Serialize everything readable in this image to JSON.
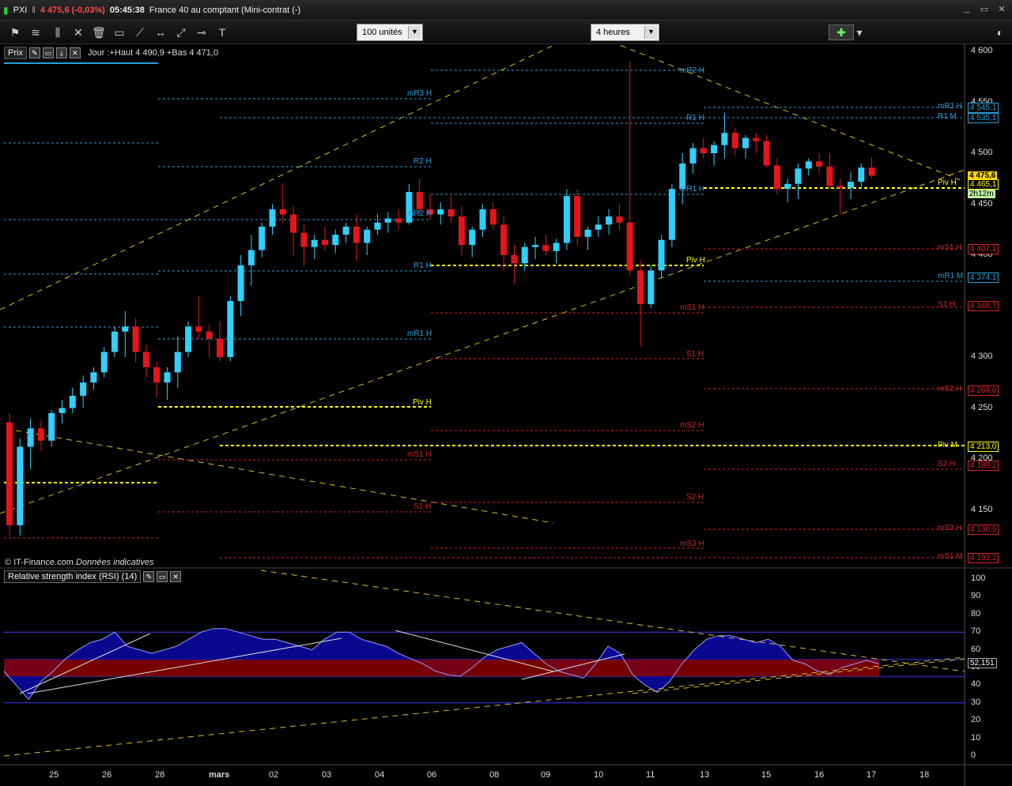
{
  "window": {
    "symbol": "PXI",
    "quote": "4 475,6 (-0,03%)",
    "time": "05:45:38",
    "instrument": "France 40 au comptant (Mini-contrat  (-)"
  },
  "toolbar": {
    "units_select": "100 unités",
    "period_select": "4 heures"
  },
  "panel": {
    "price_label": "Prix",
    "day_info": "Jour :+Haut 4 490,9 +Bas 4 471,0",
    "rsi_label": "Relative strength index (RSI) (14)",
    "credit": "© IT-Finance.com",
    "credit_note": "Données indicatives"
  },
  "colors": {
    "bull": "#2fd0ff",
    "bear": "#e8141c",
    "pivot": "#ffff00",
    "resistance": "#2a9fd8",
    "support": "#d42424",
    "rsi_fill": "#0a0aa0",
    "rsi_red": "#8b0000"
  },
  "price_axis": {
    "ticks": [
      "4 600",
      "4 550",
      "4 500",
      "4 450",
      "4 400",
      "4 350",
      "4 300",
      "4 250",
      "4 200",
      "4 150"
    ],
    "current_price_tag": "4 475,6",
    "timer_tag": "2h12m",
    "value_tags": [
      {
        "label": "mR1 H",
        "value": "4 545,1",
        "kind": "resistance"
      },
      {
        "label": "R1 M",
        "value": "4 535,1",
        "kind": "resistance"
      },
      {
        "label": "Piv H",
        "value": "4 465,1",
        "kind": "pivot"
      },
      {
        "label": "mS1 H",
        "value": "4 407,1",
        "kind": "support"
      },
      {
        "label": "mR1 M",
        "value": "4 374,1",
        "kind": "resistance"
      },
      {
        "label": "S1 H",
        "value": "4 348,7",
        "kind": "support"
      },
      {
        "label": "mS2 H",
        "value": "4 269,0",
        "kind": "support"
      },
      {
        "label": "Piv M",
        "value": "4 213,0",
        "kind": "pivot"
      },
      {
        "label": "S2 H",
        "value": "4 189,2",
        "kind": "support"
      },
      {
        "label": "mS3 H",
        "value": "4 130,9",
        "kind": "support"
      },
      {
        "label": "mS1 M",
        "value": "4 103,2",
        "kind": "support"
      }
    ]
  },
  "level_labels": [
    "mR2 H",
    "mR3 H",
    "R1 H",
    "R2 H",
    "mR2 H",
    "mR1 H",
    "R1 H",
    "Piv H",
    "mR1 H",
    "Piv H",
    "mS1 H",
    "S1 H",
    "mS2 H",
    "mS1 H",
    "S1 H",
    "S2 H",
    "mS3 H"
  ],
  "rsi_axis": {
    "ticks": [
      "100",
      "90",
      "80",
      "70",
      "60",
      "50",
      "40",
      "30",
      "20",
      "10",
      "0"
    ],
    "value_tag": "52,151"
  },
  "x_axis": {
    "ticks": [
      "25",
      "26",
      "28",
      "mars",
      "02",
      "03",
      "04",
      "06",
      "08",
      "09",
      "10",
      "11",
      "13",
      "15",
      "16",
      "17",
      "18"
    ]
  },
  "chart_data": {
    "type": "candlestick",
    "y_range": [
      4100,
      4600
    ],
    "candles": [
      [
        4236,
        4245,
        4125,
        4135
      ],
      [
        4135,
        4220,
        4125,
        4212
      ],
      [
        4212,
        4240,
        4190,
        4230
      ],
      [
        4230,
        4238,
        4208,
        4218
      ],
      [
        4218,
        4248,
        4212,
        4245
      ],
      [
        4245,
        4258,
        4235,
        4250
      ],
      [
        4250,
        4270,
        4245,
        4262
      ],
      [
        4262,
        4282,
        4250,
        4275
      ],
      [
        4275,
        4290,
        4268,
        4285
      ],
      [
        4285,
        4310,
        4280,
        4305
      ],
      [
        4305,
        4330,
        4300,
        4325
      ],
      [
        4325,
        4345,
        4300,
        4330
      ],
      [
        4330,
        4338,
        4295,
        4305
      ],
      [
        4305,
        4312,
        4280,
        4290
      ],
      [
        4290,
        4295,
        4260,
        4275
      ],
      [
        4275,
        4290,
        4258,
        4285
      ],
      [
        4285,
        4320,
        4270,
        4305
      ],
      [
        4305,
        4335,
        4300,
        4330
      ],
      [
        4330,
        4360,
        4318,
        4325
      ],
      [
        4325,
        4332,
        4300,
        4318
      ],
      [
        4318,
        4335,
        4296,
        4300
      ],
      [
        4300,
        4360,
        4296,
        4355
      ],
      [
        4355,
        4400,
        4340,
        4390
      ],
      [
        4390,
        4420,
        4370,
        4405
      ],
      [
        4405,
        4432,
        4398,
        4428
      ],
      [
        4428,
        4450,
        4420,
        4445
      ],
      [
        4445,
        4470,
        4432,
        4440
      ],
      [
        4440,
        4448,
        4400,
        4422
      ],
      [
        4422,
        4430,
        4390,
        4408
      ],
      [
        4408,
        4420,
        4396,
        4415
      ],
      [
        4415,
        4428,
        4405,
        4410
      ],
      [
        4410,
        4425,
        4402,
        4420
      ],
      [
        4420,
        4432,
        4412,
        4428
      ],
      [
        4428,
        4440,
        4395,
        4412
      ],
      [
        4412,
        4428,
        4400,
        4425
      ],
      [
        4425,
        4440,
        4420,
        4432
      ],
      [
        4432,
        4442,
        4422,
        4436
      ],
      [
        4436,
        4445,
        4425,
        4432
      ],
      [
        4432,
        4470,
        4430,
        4462
      ],
      [
        4462,
        4475,
        4440,
        4445
      ],
      [
        4445,
        4460,
        4435,
        4440
      ],
      [
        4440,
        4452,
        4430,
        4445
      ],
      [
        4445,
        4458,
        4432,
        4438
      ],
      [
        4438,
        4448,
        4400,
        4410
      ],
      [
        4410,
        4428,
        4398,
        4425
      ],
      [
        4425,
        4450,
        4418,
        4445
      ],
      [
        4445,
        4452,
        4425,
        4430
      ],
      [
        4430,
        4438,
        4385,
        4400
      ],
      [
        4400,
        4410,
        4372,
        4392
      ],
      [
        4392,
        4412,
        4385,
        4408
      ],
      [
        4408,
        4418,
        4396,
        4410
      ],
      [
        4410,
        4420,
        4400,
        4404
      ],
      [
        4404,
        4416,
        4392,
        4412
      ],
      [
        4412,
        4465,
        4405,
        4458
      ],
      [
        4458,
        4465,
        4410,
        4418
      ],
      [
        4418,
        4428,
        4405,
        4425
      ],
      [
        4425,
        4438,
        4418,
        4430
      ],
      [
        4430,
        4445,
        4420,
        4438
      ],
      [
        4438,
        4450,
        4425,
        4432
      ],
      [
        4432,
        4590,
        4380,
        4385
      ],
      [
        4385,
        4395,
        4310,
        4352
      ],
      [
        4352,
        4390,
        4348,
        4385
      ],
      [
        4385,
        4420,
        4378,
        4415
      ],
      [
        4415,
        4470,
        4408,
        4465
      ],
      [
        4465,
        4500,
        4450,
        4490
      ],
      [
        4490,
        4510,
        4480,
        4505
      ],
      [
        4505,
        4515,
        4495,
        4500
      ],
      [
        4500,
        4512,
        4488,
        4508
      ],
      [
        4508,
        4540,
        4495,
        4520
      ],
      [
        4520,
        4525,
        4498,
        4505
      ],
      [
        4505,
        4518,
        4495,
        4515
      ],
      [
        4515,
        4520,
        4500,
        4512
      ],
      [
        4512,
        4518,
        4486,
        4488
      ],
      [
        4488,
        4495,
        4460,
        4465
      ],
      [
        4465,
        4475,
        4452,
        4470
      ],
      [
        4470,
        4490,
        4455,
        4485
      ],
      [
        4485,
        4495,
        4478,
        4492
      ],
      [
        4492,
        4500,
        4480,
        4487
      ],
      [
        4487,
        4500,
        4465,
        4468
      ],
      [
        4468,
        4475,
        4440,
        4466
      ],
      [
        4466,
        4482,
        4455,
        4472
      ],
      [
        4472,
        4490,
        4465,
        4486
      ],
      [
        4486,
        4496,
        4476,
        4478
      ]
    ],
    "rsi": [
      48,
      40,
      32,
      42,
      48,
      55,
      60,
      64,
      66,
      70,
      62,
      60,
      58,
      60,
      62,
      66,
      70,
      72,
      72,
      70,
      68,
      66,
      66,
      64,
      62,
      60,
      66,
      70,
      70,
      66,
      64,
      62,
      58,
      55,
      52,
      48,
      46,
      45,
      50,
      56,
      60,
      62,
      64,
      58,
      52,
      48,
      46,
      44,
      52,
      62,
      58,
      46,
      40,
      36,
      42,
      52,
      60,
      66,
      68,
      68,
      66,
      64,
      66,
      62,
      54,
      52,
      48,
      46,
      50,
      52,
      54,
      52
    ],
    "rsi_levels": [
      70,
      54.5,
      45,
      30
    ]
  }
}
